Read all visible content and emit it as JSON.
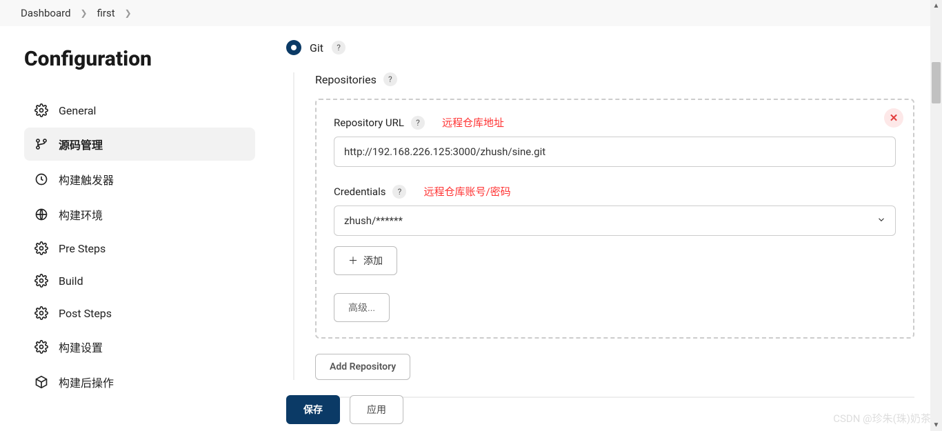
{
  "breadcrumb": {
    "items": [
      "Dashboard",
      "first"
    ]
  },
  "page_title": "Configuration",
  "sidebar": {
    "items": [
      {
        "label": "General",
        "icon": "gear"
      },
      {
        "label": "源码管理",
        "icon": "branch",
        "active": true
      },
      {
        "label": "构建触发器",
        "icon": "clock"
      },
      {
        "label": "构建环境",
        "icon": "globe"
      },
      {
        "label": "Pre Steps",
        "icon": "gear"
      },
      {
        "label": "Build",
        "icon": "gear"
      },
      {
        "label": "Post Steps",
        "icon": "gear"
      },
      {
        "label": "构建设置",
        "icon": "gear"
      },
      {
        "label": "构建后操作",
        "icon": "box"
      }
    ]
  },
  "scm": {
    "selected_label": "Git",
    "repositories_label": "Repositories",
    "repo_url_label": "Repository URL",
    "repo_url_value": "http://192.168.226.125:3000/zhush/sine.git",
    "repo_url_annotation": "远程仓库地址",
    "credentials_label": "Credentials",
    "credentials_value": "zhush/******",
    "credentials_annotation": "远程仓库账号/密码",
    "add_cred_label": "添加",
    "advanced_label": "高级...",
    "add_repo_label": "Add Repository"
  },
  "footer": {
    "save_label": "保存",
    "apply_label": "应用"
  },
  "watermark": "CSDN @珍朱(珠)奶茶"
}
